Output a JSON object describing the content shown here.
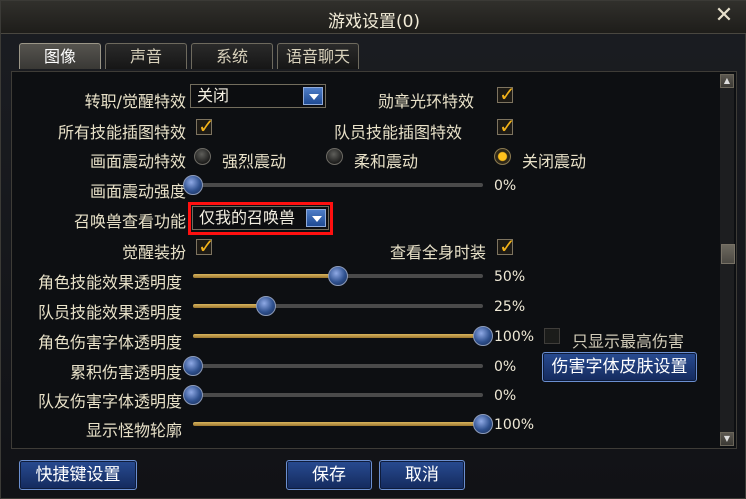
{
  "window": {
    "title": "游戏设置(0)"
  },
  "tabs": [
    "图像",
    "声音",
    "系统",
    "语音聊天"
  ],
  "settings": {
    "job_awaken_effect": {
      "label": "转职/觉醒特效",
      "value": "关闭"
    },
    "medal_ring_effect": {
      "label": "勋章光环特效",
      "checked": true
    },
    "all_skill_cutin": {
      "label": "所有技能插图特效",
      "checked": true
    },
    "team_skill_cutin": {
      "label": "队员技能插图特效",
      "checked": true
    },
    "screen_shake": {
      "label": "画面震动特效",
      "options": [
        "强烈震动",
        "柔和震动",
        "关闭震动"
      ],
      "selected_index": 2
    },
    "screen_shake_strength": {
      "label": "画面震动强度",
      "value_text": "0%",
      "value": 0
    },
    "summon_view": {
      "label": "召唤兽查看功能",
      "value": "仅我的召唤兽"
    },
    "awaken_costume": {
      "label": "觉醒装扮",
      "checked": true
    },
    "view_full_costume": {
      "label": "查看全身时装",
      "checked": true
    },
    "char_skill_alpha": {
      "label": "角色技能效果透明度",
      "value_text": "50%",
      "value": 0.5
    },
    "team_skill_alpha": {
      "label": "队员技能效果透明度",
      "value_text": "25%",
      "value": 0.25
    },
    "char_damage_font_alpha": {
      "label": "角色伤害字体透明度",
      "value_text": "100%",
      "value": 1.0
    },
    "accum_damage_alpha": {
      "label": "累积伤害透明度",
      "value_text": "0%",
      "value": 0
    },
    "ally_damage_font_alpha": {
      "label": "队友伤害字体透明度",
      "value_text": "0%",
      "value": 0
    },
    "monster_outline": {
      "label": "显示怪物轮廓",
      "value_text": "100%",
      "value": 1.0
    },
    "show_max_damage_only": {
      "label": "只显示最高伤害",
      "checked": false
    },
    "damage_font_skin_btn": "伤害字体皮肤设置"
  },
  "footer": {
    "shortcut_btn": "快捷键设置",
    "save_btn": "保存",
    "cancel_btn": "取消"
  }
}
